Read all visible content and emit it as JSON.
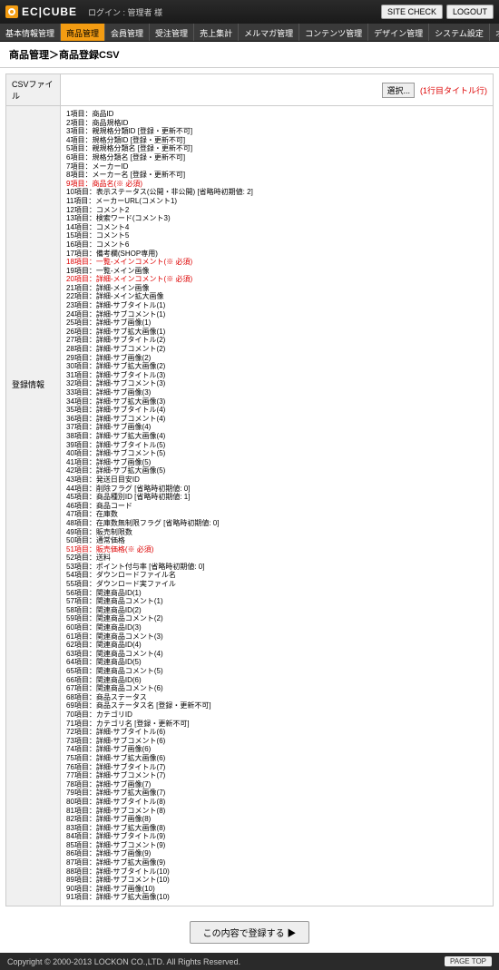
{
  "header": {
    "logo": "EC|CUBE",
    "login_info": "ログイン : 管理者 様",
    "site_check": "SITE CHECK",
    "logout": "LOGOUT"
  },
  "nav": [
    "基本情報管理",
    "商品管理",
    "会員管理",
    "受注管理",
    "売上集計",
    "メルマガ管理",
    "コンテンツ管理",
    "デザイン管理",
    "システム設定",
    "オーナーズストア"
  ],
  "nav_active_index": 1,
  "breadcrumb": "商品管理＞商品登録CSV",
  "form": {
    "csv_label": "CSVファイル",
    "file_button": "選択...",
    "file_note": "(1行目タイトル行)",
    "items_label": "登録情報"
  },
  "items": [
    {
      "t": "1項目：商品ID",
      "r": 0
    },
    {
      "t": "2項目：商品規格ID",
      "r": 0
    },
    {
      "t": "3項目：親規格分類ID [登録・更新不可]",
      "r": 0
    },
    {
      "t": "4項目：規格分類ID [登録・更新不可]",
      "r": 0
    },
    {
      "t": "5項目：親規格分類名 [登録・更新不可]",
      "r": 0
    },
    {
      "t": "6項目：規格分類名 [登録・更新不可]",
      "r": 0
    },
    {
      "t": "7項目：メーカーID",
      "r": 0
    },
    {
      "t": "8項目：メーカー名 [登録・更新不可]",
      "r": 0
    },
    {
      "t": "9項目：商品名(※ 必須)",
      "r": 1
    },
    {
      "t": "10項目：表示ステータス(公開・非公開) [省略時初期値: 2]",
      "r": 0
    },
    {
      "t": "11項目：メーカーURL(コメント1)",
      "r": 0
    },
    {
      "t": "12項目：コメント2",
      "r": 0
    },
    {
      "t": "13項目：検索ワード(コメント3)",
      "r": 0
    },
    {
      "t": "14項目：コメント4",
      "r": 0
    },
    {
      "t": "15項目：コメント5",
      "r": 0
    },
    {
      "t": "16項目：コメント6",
      "r": 0
    },
    {
      "t": "17項目：備考欄(SHOP専用)",
      "r": 0
    },
    {
      "t": "18項目：一覧-メインコメント(※ 必須)",
      "r": 1
    },
    {
      "t": "19項目：一覧-メイン画像",
      "r": 0
    },
    {
      "t": "20項目：詳細-メインコメント(※ 必須)",
      "r": 1
    },
    {
      "t": "21項目：詳細-メイン画像",
      "r": 0
    },
    {
      "t": "22項目：詳細-メイン拡大画像",
      "r": 0
    },
    {
      "t": "23項目：詳細-サブタイトル(1)",
      "r": 0
    },
    {
      "t": "24項目：詳細-サブコメント(1)",
      "r": 0
    },
    {
      "t": "25項目：詳細-サブ画像(1)",
      "r": 0
    },
    {
      "t": "26項目：詳細-サブ拡大画像(1)",
      "r": 0
    },
    {
      "t": "27項目：詳細-サブタイトル(2)",
      "r": 0
    },
    {
      "t": "28項目：詳細-サブコメント(2)",
      "r": 0
    },
    {
      "t": "29項目：詳細-サブ画像(2)",
      "r": 0
    },
    {
      "t": "30項目：詳細-サブ拡大画像(2)",
      "r": 0
    },
    {
      "t": "31項目：詳細-サブタイトル(3)",
      "r": 0
    },
    {
      "t": "32項目：詳細-サブコメント(3)",
      "r": 0
    },
    {
      "t": "33項目：詳細-サブ画像(3)",
      "r": 0
    },
    {
      "t": "34項目：詳細-サブ拡大画像(3)",
      "r": 0
    },
    {
      "t": "35項目：詳細-サブタイトル(4)",
      "r": 0
    },
    {
      "t": "36項目：詳細-サブコメント(4)",
      "r": 0
    },
    {
      "t": "37項目：詳細-サブ画像(4)",
      "r": 0
    },
    {
      "t": "38項目：詳細-サブ拡大画像(4)",
      "r": 0
    },
    {
      "t": "39項目：詳細-サブタイトル(5)",
      "r": 0
    },
    {
      "t": "40項目：詳細-サブコメント(5)",
      "r": 0
    },
    {
      "t": "41項目：詳細-サブ画像(5)",
      "r": 0
    },
    {
      "t": "42項目：詳細-サブ拡大画像(5)",
      "r": 0
    },
    {
      "t": "43項目：発送日目安ID",
      "r": 0
    },
    {
      "t": "44項目：削除フラグ [省略時初期値: 0]",
      "r": 0
    },
    {
      "t": "45項目：商品種別ID [省略時初期値: 1]",
      "r": 0
    },
    {
      "t": "46項目：商品コード",
      "r": 0
    },
    {
      "t": "47項目：在庫数",
      "r": 0
    },
    {
      "t": "48項目：在庫数無制限フラグ [省略時初期値: 0]",
      "r": 0
    },
    {
      "t": "49項目：販売制限数",
      "r": 0
    },
    {
      "t": "50項目：通常価格",
      "r": 0
    },
    {
      "t": "51項目：販売価格(※ 必須)",
      "r": 1
    },
    {
      "t": "52項目：送料",
      "r": 0
    },
    {
      "t": "53項目：ポイント付与率 [省略時初期値: 0]",
      "r": 0
    },
    {
      "t": "54項目：ダウンロードファイル名",
      "r": 0
    },
    {
      "t": "55項目：ダウンロード実ファイル",
      "r": 0
    },
    {
      "t": "56項目：関連商品ID(1)",
      "r": 0
    },
    {
      "t": "57項目：関連商品コメント(1)",
      "r": 0
    },
    {
      "t": "58項目：関連商品ID(2)",
      "r": 0
    },
    {
      "t": "59項目：関連商品コメント(2)",
      "r": 0
    },
    {
      "t": "60項目：関連商品ID(3)",
      "r": 0
    },
    {
      "t": "61項目：関連商品コメント(3)",
      "r": 0
    },
    {
      "t": "62項目：関連商品ID(4)",
      "r": 0
    },
    {
      "t": "63項目：関連商品コメント(4)",
      "r": 0
    },
    {
      "t": "64項目：関連商品ID(5)",
      "r": 0
    },
    {
      "t": "65項目：関連商品コメント(5)",
      "r": 0
    },
    {
      "t": "66項目：関連商品ID(6)",
      "r": 0
    },
    {
      "t": "67項目：関連商品コメント(6)",
      "r": 0
    },
    {
      "t": "68項目：商品ステータス",
      "r": 0
    },
    {
      "t": "69項目：商品ステータス名 [登録・更新不可]",
      "r": 0
    },
    {
      "t": "70項目：カテゴリID",
      "r": 0
    },
    {
      "t": "71項目：カテゴリ名 [登録・更新不可]",
      "r": 0
    },
    {
      "t": "72項目：詳細-サブタイトル(6)",
      "r": 0
    },
    {
      "t": "73項目：詳細-サブコメント(6)",
      "r": 0
    },
    {
      "t": "74項目：詳細-サブ画像(6)",
      "r": 0
    },
    {
      "t": "75項目：詳細-サブ拡大画像(6)",
      "r": 0
    },
    {
      "t": "76項目：詳細-サブタイトル(7)",
      "r": 0
    },
    {
      "t": "77項目：詳細-サブコメント(7)",
      "r": 0
    },
    {
      "t": "78項目：詳細-サブ画像(7)",
      "r": 0
    },
    {
      "t": "79項目：詳細-サブ拡大画像(7)",
      "r": 0
    },
    {
      "t": "80項目：詳細-サブタイトル(8)",
      "r": 0
    },
    {
      "t": "81項目：詳細-サブコメント(8)",
      "r": 0
    },
    {
      "t": "82項目：詳細-サブ画像(8)",
      "r": 0
    },
    {
      "t": "83項目：詳細-サブ拡大画像(8)",
      "r": 0
    },
    {
      "t": "84項目：詳細-サブタイトル(9)",
      "r": 0
    },
    {
      "t": "85項目：詳細-サブコメント(9)",
      "r": 0
    },
    {
      "t": "86項目：詳細-サブ画像(9)",
      "r": 0
    },
    {
      "t": "87項目：詳細-サブ拡大画像(9)",
      "r": 0
    },
    {
      "t": "88項目：詳細-サブタイトル(10)",
      "r": 0
    },
    {
      "t": "89項目：詳細-サブコメント(10)",
      "r": 0
    },
    {
      "t": "90項目：詳細-サブ画像(10)",
      "r": 0
    },
    {
      "t": "91項目：詳細-サブ拡大画像(10)",
      "r": 0
    }
  ],
  "submit": "この内容で登録する ▶",
  "footer": {
    "copyright": "Copyright © 2000-2013 LOCKON CO.,LTD. All Rights Reserved.",
    "page_top": "PAGE TOP"
  }
}
